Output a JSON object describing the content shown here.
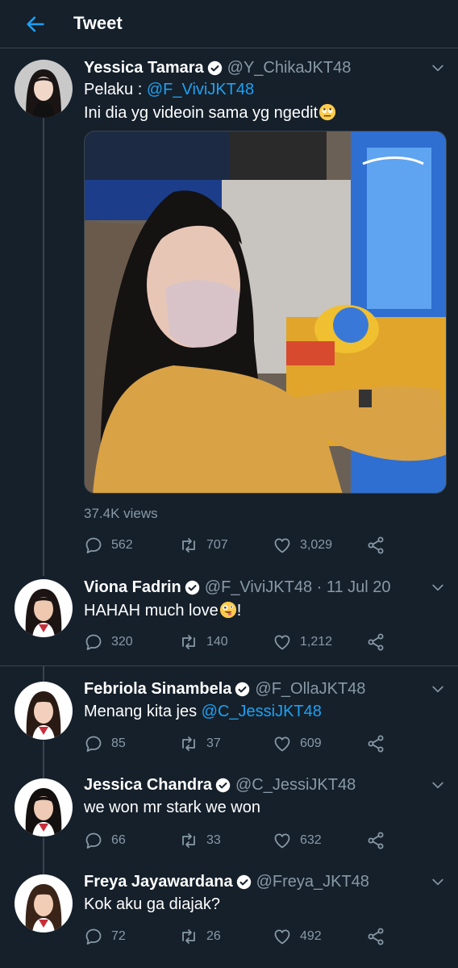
{
  "header": {
    "title": "Tweet"
  },
  "main_tweet": {
    "display_name": "Yessica Tamara",
    "handle": "@Y_ChikaJKT48",
    "line1_prefix": "Pelaku : ",
    "line1_mention": "@F_ViviJKT48",
    "line2_text": "Ini dia yg videoin sama yg ngedit",
    "line2_emoji": "rolling-eyes-emoji",
    "views": "37.4K views",
    "replies": "562",
    "retweets": "707",
    "likes": "3,029"
  },
  "replies": [
    {
      "display_name": "Viona Fadrin",
      "handle": "@F_ViviJKT48 · 11 Jul 20",
      "text": "HAHAH much love",
      "text_suffix": "!",
      "emoji": "zany-face-emoji",
      "replies": "320",
      "retweets": "140",
      "likes": "1,212"
    },
    {
      "display_name": "Febriola Sinambela",
      "handle": "@F_OllaJKT48",
      "text": "Menang kita jes ",
      "mention": "@C_JessiJKT48",
      "replies": "85",
      "retweets": "37",
      "likes": "609"
    },
    {
      "display_name": "Jessica Chandra",
      "handle": "@C_JessiJKT48",
      "text": "we won mr stark we won",
      "replies": "66",
      "retweets": "33",
      "likes": "632"
    },
    {
      "display_name": "Freya Jayawardana",
      "handle": "@Freya_JKT48",
      "text": "Kok aku ga diajak?",
      "replies": "72",
      "retweets": "26",
      "likes": "492"
    }
  ],
  "colors": {
    "background": "#15202b",
    "accent": "#1da1f2",
    "secondary_text": "#8899a6",
    "divider": "#38444d"
  }
}
